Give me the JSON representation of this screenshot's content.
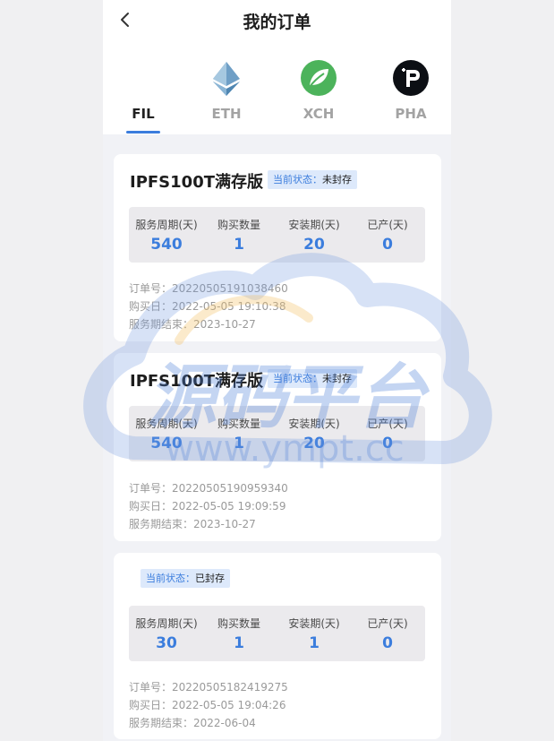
{
  "header": {
    "title": "我的订单"
  },
  "tabs": [
    {
      "label": "FIL",
      "icon": "fil-tab",
      "active": true
    },
    {
      "label": "ETH",
      "icon": "ethereum-icon",
      "active": false
    },
    {
      "label": "XCH",
      "icon": "chia-leaf-icon",
      "active": false
    },
    {
      "label": "PHA",
      "icon": "phala-icon",
      "active": false
    }
  ],
  "orders": [
    {
      "title": "IPFS100T满存版",
      "status_label": "当前状态：",
      "status_value": "未封存",
      "stats": [
        {
          "label": "服务周期(天)",
          "value": "540"
        },
        {
          "label": "购买数量",
          "value": "1"
        },
        {
          "label": "安装期(天)",
          "value": "20"
        },
        {
          "label": "已产(天)",
          "value": "0"
        }
      ],
      "order_no": "订单号：20220505191038460",
      "buy_date": "购买日：2022-05-05 19:10:38",
      "end_date": "服务期结束：2023-10-27"
    },
    {
      "title": "IPFS100T满存版",
      "status_label": "当前状态：",
      "status_value": "未封存",
      "stats": [
        {
          "label": "服务周期(天)",
          "value": "540"
        },
        {
          "label": "购买数量",
          "value": "1"
        },
        {
          "label": "安装期(天)",
          "value": "20"
        },
        {
          "label": "已产(天)",
          "value": "0"
        }
      ],
      "order_no": "订单号：20220505190959340",
      "buy_date": "购买日：2022-05-05 19:09:59",
      "end_date": "服务期结束：2023-10-27"
    },
    {
      "title": "",
      "status_label": "当前状态：",
      "status_value": "已封存",
      "stats": [
        {
          "label": "服务周期(天)",
          "value": "30"
        },
        {
          "label": "购买数量",
          "value": "1"
        },
        {
          "label": "安装期(天)",
          "value": "1"
        },
        {
          "label": "已产(天)",
          "value": "0"
        }
      ],
      "order_no": "订单号：20220505182419275",
      "buy_date": "购买日：2022-05-05 19:04:26",
      "end_date": "服务期结束：2022-06-04"
    }
  ],
  "watermark": {
    "title": "源码平台",
    "url": "www.ympt.cc"
  },
  "colors": {
    "accent": "#3b7ddd",
    "badge_bg": "#dde9fb",
    "stats_bg": "#ebeaed",
    "page_bg": "#f1f2f6"
  }
}
